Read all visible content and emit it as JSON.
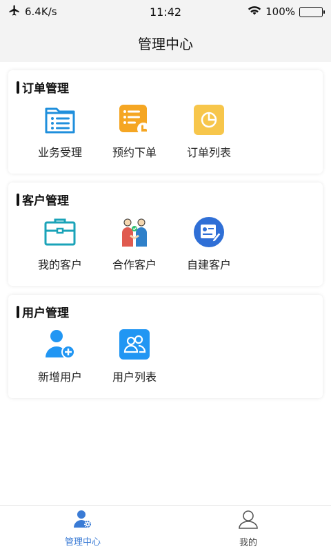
{
  "status_bar": {
    "speed": "6.4K/s",
    "time": "11:42",
    "battery": "100%"
  },
  "nav": {
    "title": "管理中心"
  },
  "sections": [
    {
      "title": "订单管理",
      "items": [
        {
          "label": "业务受理",
          "icon": "folder-list-icon"
        },
        {
          "label": "预约下单",
          "icon": "appointment-icon"
        },
        {
          "label": "订单列表",
          "icon": "pie-chart-icon"
        }
      ]
    },
    {
      "title": "客户管理",
      "items": [
        {
          "label": "我的客户",
          "icon": "briefcase-icon"
        },
        {
          "label": "合作客户",
          "icon": "handshake-icon"
        },
        {
          "label": "自建客户",
          "icon": "certificate-icon"
        }
      ]
    },
    {
      "title": "用户管理",
      "items": [
        {
          "label": "新增用户",
          "icon": "add-user-icon"
        },
        {
          "label": "用户列表",
          "icon": "users-icon"
        }
      ]
    }
  ],
  "tabs": [
    {
      "label": "管理中心",
      "active": true
    },
    {
      "label": "我的",
      "active": false
    }
  ],
  "colors": {
    "accent": "#3a7bd5",
    "icon_blue": "#2196f3",
    "icon_orange": "#f5a623",
    "icon_yellow": "#f7c64b",
    "icon_teal": "#1aa3b8"
  }
}
